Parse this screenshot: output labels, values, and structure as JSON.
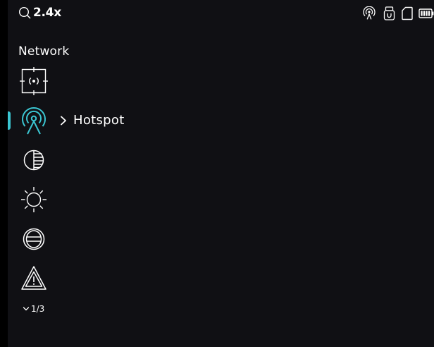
{
  "status_bar": {
    "zoom_level": "2.4x",
    "zoom_icon": "search-icon",
    "indicators": [
      "hotspot-icon",
      "usb-icon",
      "sd-card-icon",
      "battery-icon"
    ]
  },
  "menu": {
    "title": "Network",
    "items": [
      {
        "icon": "target-icon"
      },
      {
        "icon": "hotspot-icon",
        "selected": true,
        "submenu_label": "Hotspot"
      },
      {
        "icon": "contrast-icon"
      },
      {
        "icon": "brightness-icon"
      },
      {
        "icon": "display-mode-icon"
      },
      {
        "icon": "warning-icon"
      }
    ],
    "pager": {
      "label": "1/3",
      "icon": "chevron-down-icon"
    }
  },
  "colors": {
    "accent": "#3bc6d2",
    "background": "#101014",
    "foreground": "#ffffff"
  }
}
